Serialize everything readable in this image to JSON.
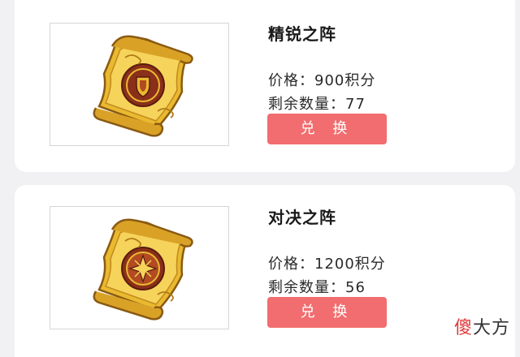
{
  "items": [
    {
      "name": "精锐之阵",
      "price_text": "价格：900积分",
      "remaining_text": "剩余数量：77",
      "button_label": "兑 换",
      "emblem_icon": "shield-emblem-icon"
    },
    {
      "name": "对决之阵",
      "price_text": "价格：1200积分",
      "remaining_text": "剩余数量：56",
      "button_label": "兑 换",
      "emblem_icon": "star-emblem-icon"
    }
  ],
  "watermark": {
    "part1": "傻",
    "part2": "大方"
  },
  "colors": {
    "page_bg": "#f1f1f3",
    "card_bg": "#ffffff",
    "button_bg": "#f16d6f",
    "scroll_gold": "#e9b930",
    "emblem_red": "#8a2f1a"
  }
}
